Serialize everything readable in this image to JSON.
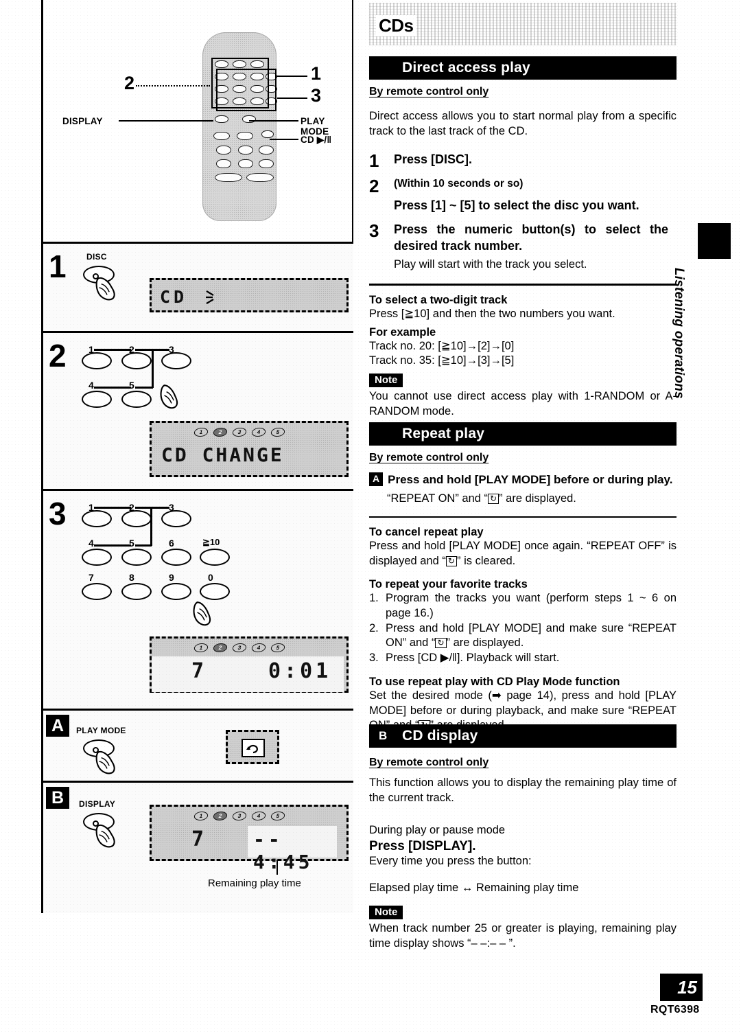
{
  "document": {
    "page_number": "15",
    "doc_code": "RQT6398",
    "side_tab": "Listening operations"
  },
  "left_column": {
    "remote_diagram": {
      "callouts": [
        {
          "id": "1",
          "label": "1"
        },
        {
          "id": "2",
          "label": "2"
        },
        {
          "id": "3",
          "label": "3"
        }
      ],
      "button_labels": [
        {
          "name": "display",
          "label": "DISPLAY"
        },
        {
          "name": "play-mode",
          "label": "PLAY MODE"
        },
        {
          "name": "cd-play-pause",
          "label": "CD ▶/‖"
        }
      ]
    },
    "step_panels": [
      {
        "num": "1",
        "button_label": "DISC",
        "lcd_text": "CD",
        "lcd_note": "flashing"
      },
      {
        "num": "2",
        "keypad": [
          "1",
          "2",
          "3",
          "4",
          "5"
        ],
        "lcd_text": "CD CHANGE",
        "disc_indicators": [
          "1",
          "2",
          "3",
          "4",
          "5"
        ],
        "active_disc": "2"
      },
      {
        "num": "3",
        "keypad": [
          "1",
          "2",
          "3",
          "4",
          "5",
          "6",
          "≧10",
          "7",
          "8",
          "9",
          "0"
        ],
        "lcd_track": "7",
        "lcd_time": "0:01",
        "disc_indicators": [
          "1",
          "2",
          "3",
          "4",
          "5"
        ],
        "active_disc": "2"
      }
    ],
    "lettered_panels": [
      {
        "letter": "A",
        "button_label": "PLAY MODE",
        "lcd_icon": "repeat-icon"
      },
      {
        "letter": "B",
        "button_label": "DISPLAY",
        "lcd_track": "7",
        "lcd_time": "-- 4:45",
        "caption": "Remaining play time",
        "disc_indicators": [
          "1",
          "2",
          "3",
          "4",
          "5"
        ],
        "active_disc": "2"
      }
    ]
  },
  "right_column": {
    "page_title": "CDs",
    "sections": [
      {
        "id": "direct-access-play",
        "heading": "Direct access play",
        "badge": "",
        "subheading": "By remote control only",
        "intro": "Direct access allows you to start normal play from a specific track to the last track of the CD.",
        "steps": [
          {
            "num": "1",
            "text": "Press [DISC]."
          },
          {
            "num": "2",
            "text": "(Within 10 seconds or so)",
            "text2": "Press [1] ~ [5] to select the disc you want."
          },
          {
            "num": "3",
            "text": "Press the numeric button(s) to select the desired track number.",
            "sub": "Play will start with the track you select."
          }
        ],
        "blocks": [
          {
            "head": "To select a two-digit track",
            "body": "Press [≧10] and then the two numbers you want."
          },
          {
            "head": "For example",
            "lines": [
              "Track no. 20: [≧10]→[2]→[0]",
              "Track no. 35: [≧10]→[3]→[5]"
            ]
          }
        ],
        "note_tag": "Note",
        "note_text": "You cannot use direct access play with  1-RANDOM or A-RANDOM mode."
      },
      {
        "id": "repeat-play",
        "heading": "Repeat play",
        "badge": "",
        "subheading": "By remote control only",
        "badge_step": "A",
        "badge_step_text": "Press and hold [PLAY MODE] before or during play.",
        "badge_step_sub_pre": "“REPEAT ON” and “",
        "badge_step_sub_post": "” are displayed.",
        "blocks": [
          {
            "head": "To cancel repeat play",
            "body_pre": "Press and hold [PLAY MODE] once again. “REPEAT OFF” is displayed and “",
            "body_post": "” is cleared."
          },
          {
            "head": "To repeat your favorite tracks",
            "items": [
              {
                "mk": "1.",
                "tx": "Program the tracks you want (perform steps 1 ~ 6 on page 16.)"
              },
              {
                "mk": "2.",
                "tx_pre": "Press and hold [PLAY MODE] and make sure “REPEAT ON” and “",
                "tx_post": "” are displayed."
              },
              {
                "mk": "3.",
                "tx": "Press [CD ▶/‖]. Playback will start."
              }
            ]
          },
          {
            "head": "To use repeat play with CD Play Mode function",
            "body_pre": "Set the desired mode (➡ page 14), press and hold [PLAY MODE] before or during playback, and make sure “REPEAT ON” and “",
            "body_post": "” are displayed."
          }
        ]
      },
      {
        "id": "cd-display",
        "heading": "CD display",
        "badge": "B",
        "subheading": "By remote control only",
        "intro": "This function allows you to display the remaining play time of the current track.",
        "mode_line": "During play or pause mode",
        "press_line": "Press [DISPLAY].",
        "every_line": "Every time you press the button:",
        "toggle_line": "Elapsed play time ↔ Remaining play time",
        "note_tag": "Note",
        "note_text": "When track number 25 or greater is playing, remaining play time display shows “– –:– – ”."
      }
    ]
  }
}
